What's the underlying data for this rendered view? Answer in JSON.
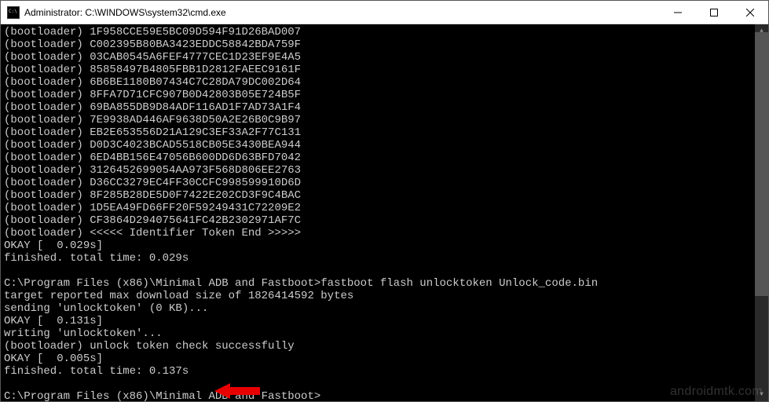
{
  "titlebar": {
    "title": "Administrator: C:\\WINDOWS\\system32\\cmd.exe"
  },
  "console": {
    "lines": [
      "(bootloader) 1F958CCE59E5BC09D594F91D26BAD007",
      "(bootloader) C002395B80BA3423EDDC58842BDA759F",
      "(bootloader) 03CAB0545A6FEF4777CEC1D23EF9E4A5",
      "(bootloader) 85858497B4805FBB1D2812FAEEC9161F",
      "(bootloader) 6B6BE1180B07434C7C28DA79DC002D64",
      "(bootloader) 8FFA7D71CFC907B0D42803B05E724B5F",
      "(bootloader) 69BA855DB9D84ADF116AD1F7AD73A1F4",
      "(bootloader) 7E9938AD446AF9638D50A2E26B0C9B97",
      "(bootloader) EB2E653556D21A129C3EF33A2F77C131",
      "(bootloader) D0D3C4023BCAD5518CB05E3430BEA944",
      "(bootloader) 6ED4BB156E47056B600DD6D63BFD7042",
      "(bootloader) 3126452699054AA973F568D806EE2763",
      "(bootloader) D36CC3279EC4FF30CCFC998599910D6D",
      "(bootloader) 8F285B28DE5D0F7422E202CD3F9C4BAC",
      "(bootloader) 1D5EA49FD66FF20F59249431C72209E2",
      "(bootloader) CF3864D294075641FC42B2302971AF7C",
      "(bootloader) <<<<< Identifier Token End >>>>>",
      "OKAY [  0.029s]",
      "finished. total time: 0.029s",
      "",
      "C:\\Program Files (x86)\\Minimal ADB and Fastboot>fastboot flash unlocktoken Unlock_code.bin",
      "target reported max download size of 1826414592 bytes",
      "sending 'unlocktoken' (0 KB)...",
      "OKAY [  0.131s]",
      "writing 'unlocktoken'...",
      "(bootloader) unlock token check successfully",
      "OKAY [  0.005s]",
      "finished. total time: 0.137s",
      "",
      "C:\\Program Files (x86)\\Minimal ADB and Fastboot>"
    ]
  },
  "watermark": "androidmtk.com"
}
